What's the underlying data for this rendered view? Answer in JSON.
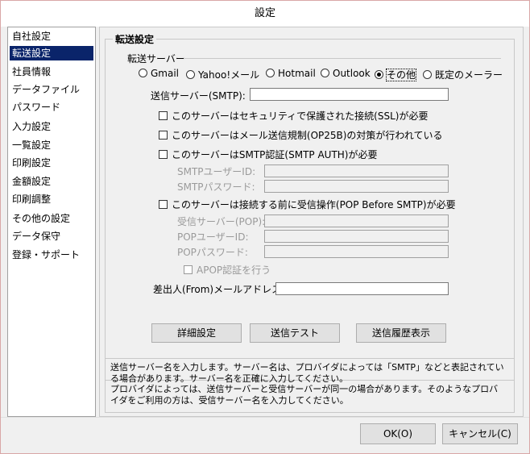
{
  "window": {
    "title": "設定"
  },
  "sidebar": {
    "items": [
      {
        "label": "自社設定"
      },
      {
        "label": "転送設定",
        "active": true
      },
      {
        "label": "社員情報"
      },
      {
        "label": "データファイル"
      },
      {
        "label": "パスワード"
      },
      {
        "label": "入力設定"
      },
      {
        "label": "一覧設定"
      },
      {
        "label": "印刷設定"
      },
      {
        "label": "金額設定"
      },
      {
        "label": "印刷調整"
      },
      {
        "label": "その他の設定"
      },
      {
        "label": "データ保守"
      },
      {
        "label": "登録・サポート"
      }
    ]
  },
  "transfer": {
    "group_title": "転送設定",
    "server_section_label": "転送サーバー",
    "radios": [
      {
        "label": "Gmail",
        "checked": false
      },
      {
        "label": "Yahoo!メール",
        "checked": false
      },
      {
        "label": "Hotmail",
        "checked": false
      },
      {
        "label": "Outlook",
        "checked": false
      },
      {
        "label": "その他",
        "checked": true
      },
      {
        "label": "既定のメーラー",
        "checked": false
      }
    ],
    "smtp_label": "送信サーバー(SMTP):",
    "smtp_value": "",
    "checks": {
      "ssl": "このサーバーはセキュリティで保護された接続(SSL)が必要",
      "op25b": "このサーバーはメール送信規制(OP25B)の対策が行われている",
      "smtp_auth": "このサーバーはSMTP認証(SMTP AUTH)が必要",
      "pop_before": "このサーバーは接続する前に受信操作(POP Before SMTP)が必要",
      "apop": "APOP認証を行う"
    },
    "smtp_user_label": "SMTPユーザーID:",
    "smtp_pass_label": "SMTPパスワード:",
    "pop_server_label": "受信サーバー(POP):",
    "pop_user_label": "POPユーザーID:",
    "pop_pass_label": "POPパスワード:",
    "from_label": "差出人(From)メールアドレス:",
    "from_value": "",
    "buttons": {
      "detail": "詳細設定",
      "test": "送信テスト",
      "history": "送信履歴表示"
    }
  },
  "help": {
    "lines": [
      "送信サーバー名を入力します。サーバー名は、プロバイダによっては「SMTP」などと表記されてい",
      "る場合があります。サーバー名を正確に入力してください。",
      "プロバイダによっては、送信サーバーと受信サーバーが同一の場合があります。そのようなプロバ",
      "イダをご利用の方は、受信サーバー名を入力してください。"
    ]
  },
  "footer": {
    "ok": "OK(O)",
    "cancel": "キャンセル(C)"
  }
}
